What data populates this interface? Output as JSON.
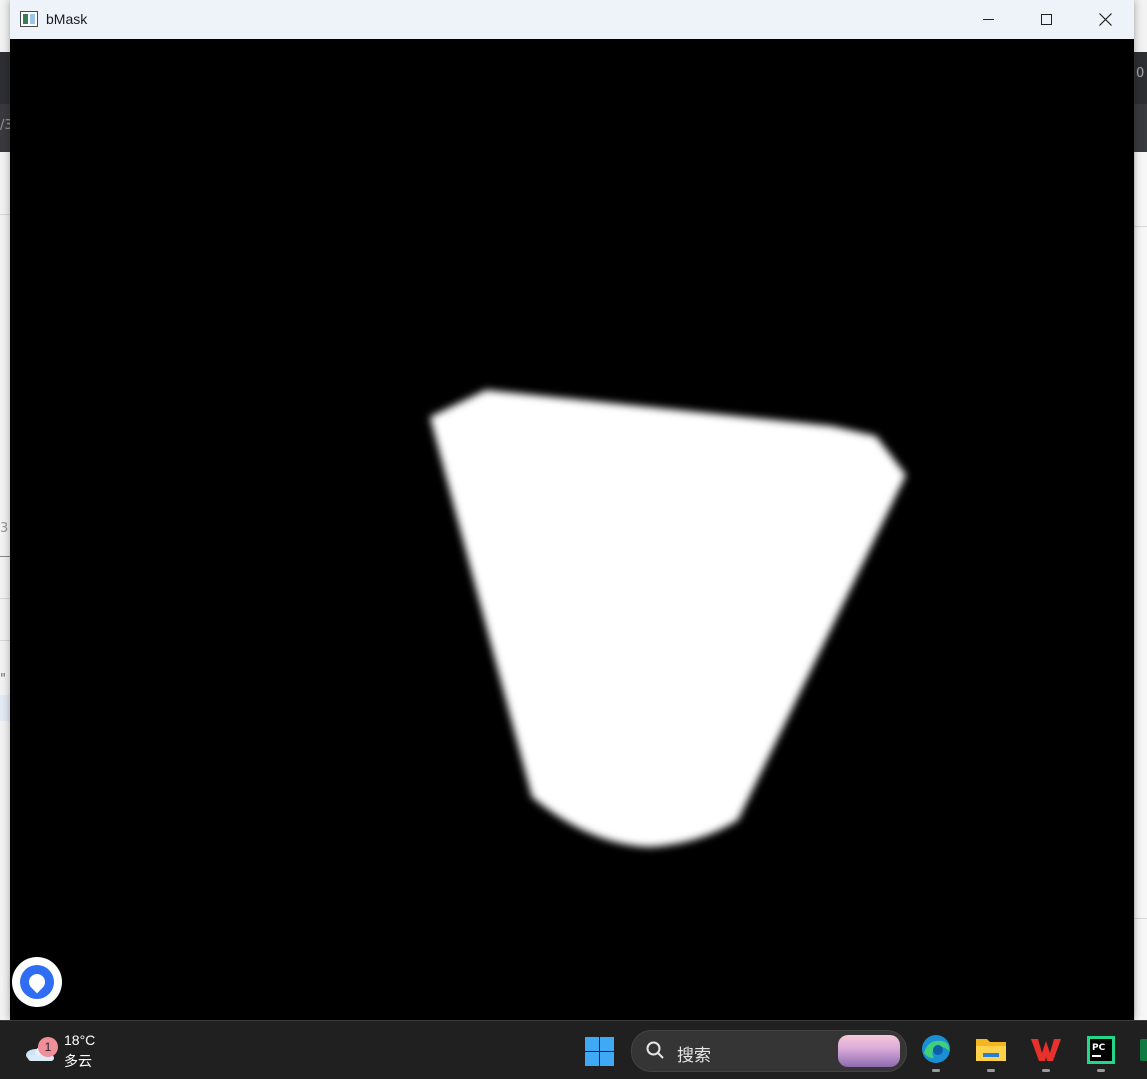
{
  "window": {
    "title": "bMask"
  },
  "background_fragments": {
    "top_right_digit": "0",
    "left_fragment_1": "/3",
    "left_fragment_2": "3",
    "left_fragment_3": "\""
  },
  "taskbar": {
    "weather": {
      "badge_count": "1",
      "temperature": "18°C",
      "condition": "多云"
    },
    "search": {
      "label": "搜索"
    },
    "apps": [
      "edge-icon",
      "file-explorer-icon",
      "wps-office-icon",
      "pycharm-icon",
      "excel-icon"
    ]
  },
  "colors": {
    "canvas_background": "#000000",
    "mask_fill": "#ffffff",
    "titlebar": "#eef3fa",
    "taskbar": "#202020"
  }
}
